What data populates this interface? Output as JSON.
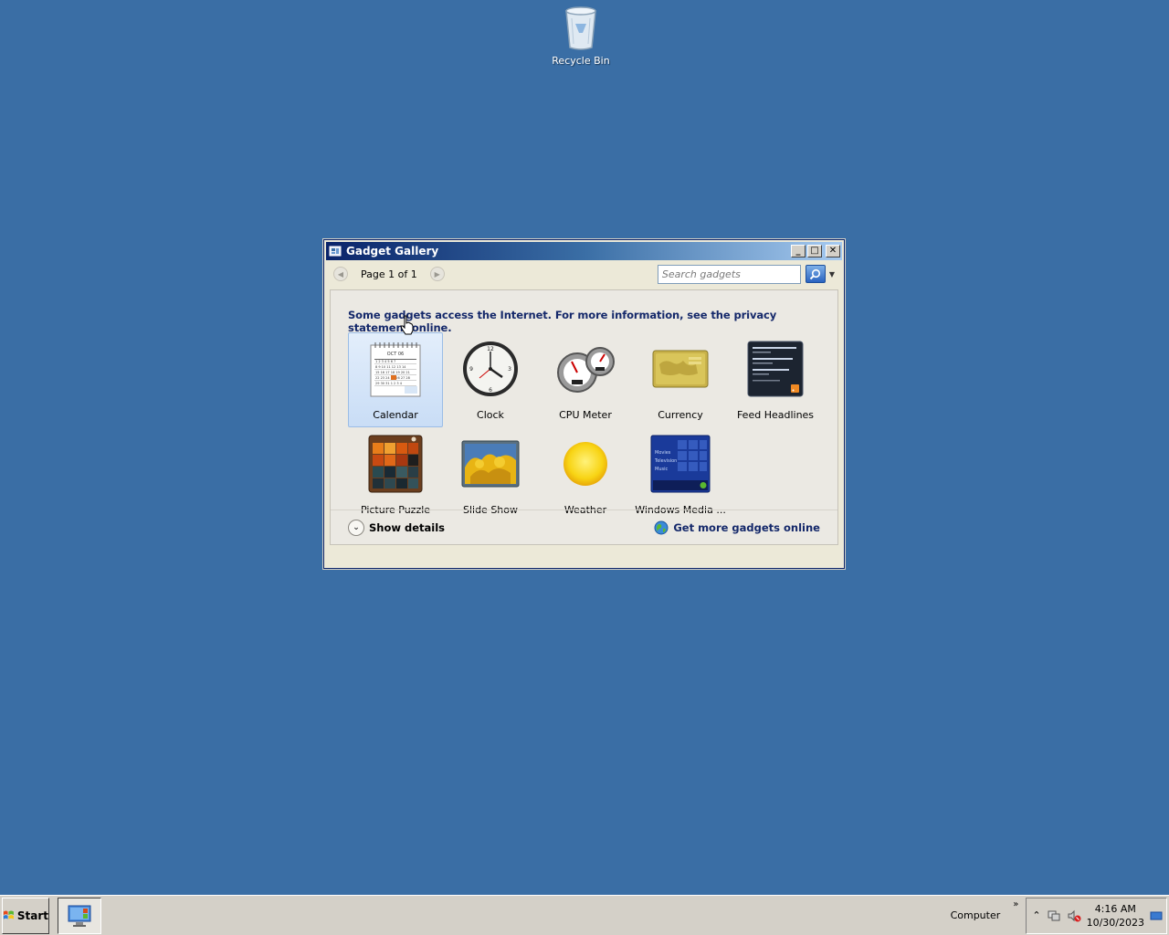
{
  "desktop": {
    "recycle_bin_label": "Recycle Bin"
  },
  "window": {
    "title": "Gadget Gallery",
    "toolbar": {
      "page_label": "Page 1 of 1",
      "search_placeholder": "Search gadgets"
    },
    "notice": "Some gadgets access the Internet.  For more information, see the privacy statement online.",
    "gadgets": [
      {
        "name": "Calendar",
        "icon": "calendar-icon",
        "selected": true
      },
      {
        "name": "Clock",
        "icon": "clock-icon"
      },
      {
        "name": "CPU Meter",
        "icon": "cpu-meter-icon"
      },
      {
        "name": "Currency",
        "icon": "currency-icon"
      },
      {
        "name": "Feed Headlines",
        "icon": "feed-headlines-icon"
      },
      {
        "name": "Picture Puzzle",
        "icon": "picture-puzzle-icon"
      },
      {
        "name": "Slide Show",
        "icon": "slide-show-icon"
      },
      {
        "name": "Weather",
        "icon": "weather-icon"
      },
      {
        "name": "Windows Media ...",
        "icon": "windows-media-icon"
      }
    ],
    "calendar_thumb_month": "OCT 06",
    "media_thumb_lines": [
      "Movies",
      "Television",
      "Music"
    ],
    "footer": {
      "show_details": "Show details",
      "get_more": "Get more gadgets online"
    }
  },
  "taskbar": {
    "start_label": "Start",
    "computer_label": "Computer",
    "time": "4:16 AM",
    "date": "10/30/2023"
  },
  "colors": {
    "desktop": "#3a6ea5",
    "title_gradient_start": "#0a246a",
    "link_text": "#14286a",
    "selection": "#c9ddf6"
  }
}
